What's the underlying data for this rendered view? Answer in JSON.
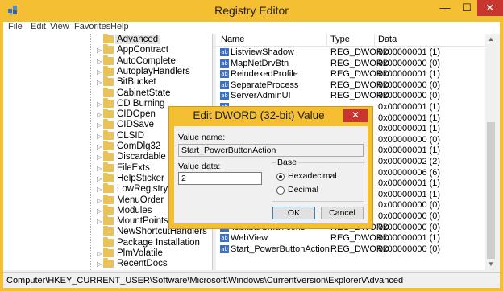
{
  "window": {
    "title": "Registry Editor",
    "minimize": "—",
    "maximize": "☐",
    "close": "✕"
  },
  "menu": [
    "File",
    "Edit",
    "View",
    "Favorites",
    "Help"
  ],
  "tree": {
    "items": [
      "Advanced",
      "AppContract",
      "AutoComplete",
      "AutoplayHandlers",
      "BitBucket",
      "CabinetState",
      "CD Burning",
      "CIDOpen",
      "CIDSave",
      "CLSID",
      "ComDlg32",
      "Discardable",
      "FileExts",
      "HelpSticker",
      "LowRegistry",
      "MenuOrder",
      "Modules",
      "MountPoints2",
      "NewShortcutHandlers",
      "Package Installation",
      "PlmVolatile",
      "RecentDocs"
    ],
    "expandable": [
      false,
      true,
      true,
      true,
      true,
      false,
      true,
      true,
      true,
      true,
      true,
      true,
      true,
      true,
      true,
      true,
      true,
      true,
      false,
      false,
      true,
      true
    ],
    "selected_index": 0
  },
  "list": {
    "headers": {
      "name": "Name",
      "type": "Type",
      "data": "Data"
    },
    "rows": [
      {
        "name": "ListviewShadow",
        "type": "REG_DWORD",
        "data": "0x00000001 (1)"
      },
      {
        "name": "MapNetDrvBtn",
        "type": "REG_DWORD",
        "data": "0x00000000 (0)"
      },
      {
        "name": "ReindexedProfile",
        "type": "REG_DWORD",
        "data": "0x00000001 (1)"
      },
      {
        "name": "SeparateProcess",
        "type": "REG_DWORD",
        "data": "0x00000000 (0)"
      },
      {
        "name": "ServerAdminUI",
        "type": "REG_DWORD",
        "data": "0x00000000 (0)"
      },
      {
        "name": "",
        "type": "",
        "data": "0x00000001 (1)"
      },
      {
        "name": "",
        "type": "",
        "data": "0x00000001 (1)"
      },
      {
        "name": "",
        "type": "",
        "data": "0x00000001 (1)"
      },
      {
        "name": "",
        "type": "",
        "data": "0x00000000 (0)"
      },
      {
        "name": "",
        "type": "",
        "data": "0x00000001 (1)"
      },
      {
        "name": "",
        "type": "",
        "data": "0x00000002 (2)"
      },
      {
        "name": "",
        "type": "",
        "data": "0x00000006 (6)"
      },
      {
        "name": "",
        "type": "",
        "data": "0x00000001 (1)"
      },
      {
        "name": "",
        "type": "",
        "data": "0x00000001 (1)"
      },
      {
        "name": "",
        "type": "",
        "data": "0x00000000 (0)"
      },
      {
        "name": "",
        "type": "",
        "data": "0x00000000 (0)"
      },
      {
        "name": "TaskbarSmallIcons",
        "type": "REG_DWORD",
        "data": "0x00000000 (0)"
      },
      {
        "name": "WebView",
        "type": "REG_DWORD",
        "data": "0x00000001 (1)"
      },
      {
        "name": "Start_PowerButtonAction",
        "type": "REG_DWORD",
        "data": "0x00000000 (0)"
      }
    ],
    "icon_text": "ab"
  },
  "status": "Computer\\HKEY_CURRENT_USER\\Software\\Microsoft\\Windows\\CurrentVersion\\Explorer\\Advanced",
  "dialog": {
    "title": "Edit DWORD (32-bit) Value",
    "close": "✕",
    "value_name_label": "Value name:",
    "value_name": "Start_PowerButtonAction",
    "value_data_label": "Value data:",
    "value_data": "2",
    "base_label": "Base",
    "hex_label": "Hexadecimal",
    "dec_label": "Decimal",
    "base_selected": "Hexadecimal",
    "ok": "OK",
    "cancel": "Cancel"
  },
  "colors": {
    "accent": "#f5bf33",
    "close": "#c7372f",
    "reg_icon": "#3c70c8"
  }
}
